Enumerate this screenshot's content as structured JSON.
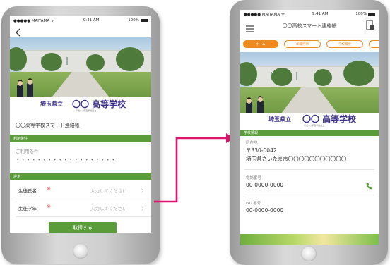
{
  "left_phone": {
    "status": {
      "carrier": "●●●●● MAITAMA ᯤ",
      "time": "9:41 AM",
      "battery": "100%"
    },
    "back_icon": "chevron-left",
    "logo": {
      "prefecture": "埼玉県立",
      "school": "〇〇 高等学校",
      "established": "平成○○年度学校創立"
    },
    "app_title": "〇〇高等学校スマート連絡帳",
    "terms_section": "利用条件",
    "terms_label": "ご利用条件",
    "terms_dots": "・・・・・・・・・・・・・・・・・・・",
    "settings_section": "設定",
    "fields": [
      {
        "label": "生徒氏名",
        "required": "※",
        "placeholder": "入力してください",
        "chevron": "〉"
      },
      {
        "label": "生徒学年",
        "required": "※",
        "placeholder": "入力してください",
        "chevron": "〉"
      }
    ],
    "submit_label": "取得する"
  },
  "right_phone": {
    "status": {
      "carrier": "●●●●● MAITAMA ᯤ",
      "time": "9:41 AM",
      "battery": "100%"
    },
    "header_title": "〇〇高校スマート連絡帳",
    "tabs": [
      {
        "label": "ホーム",
        "active": true
      },
      {
        "label": "年間行事",
        "active": false
      },
      {
        "label": "学校概要",
        "active": false
      }
    ],
    "logo": {
      "prefecture": "埼玉県立",
      "school": "〇〇 高等学校",
      "established": "平成○○年度学校創立"
    },
    "info_section": "学校情報",
    "address_label": "所在地",
    "postal": "〒330-0042",
    "address": "埼玉県さいたま市〇〇〇〇〇〇〇〇〇〇〇",
    "phone_label": "電話番号",
    "phone": "00-0000-0000",
    "fax_label": "FAX番号",
    "fax": "00-0000-0000"
  },
  "colors": {
    "green": "#5a9b3a",
    "orange": "#ef8a1e",
    "navy": "#3a2f87",
    "arrow": "#e2126f"
  }
}
